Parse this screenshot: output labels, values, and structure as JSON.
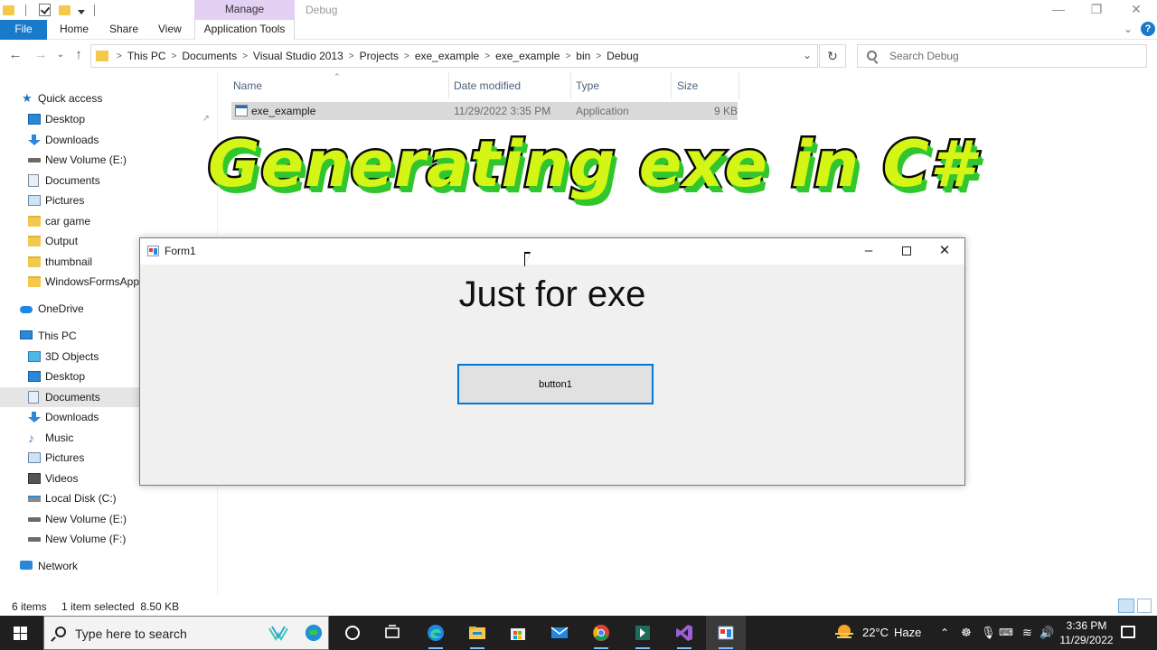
{
  "explorer": {
    "title_context_tab": "Manage",
    "title_folder": "Debug",
    "ribbon_tabs": {
      "file": "File",
      "home": "Home",
      "share": "Share",
      "view": "View",
      "app_tools": "Application Tools"
    },
    "address": {
      "crumbs": [
        "This PC",
        "Documents",
        "Visual Studio 2013",
        "Projects",
        "exe_example",
        "exe_example",
        "bin",
        "Debug"
      ],
      "search_placeholder": "Search Debug"
    },
    "sidebar": {
      "quick_access": "Quick access",
      "items": [
        {
          "label": "Desktop",
          "icon": "desktop-icon"
        },
        {
          "label": "Downloads",
          "icon": "downloads-icon"
        },
        {
          "label": "New Volume (E:)",
          "icon": "drive-icon"
        },
        {
          "label": "Documents",
          "icon": "documents-icon"
        },
        {
          "label": "Pictures",
          "icon": "pictures-icon"
        },
        {
          "label": "car game",
          "icon": "folder-icon"
        },
        {
          "label": "Output",
          "icon": "folder-icon"
        },
        {
          "label": "thumbnail",
          "icon": "folder-icon"
        },
        {
          "label": "WindowsFormsApplication",
          "icon": "folder-icon"
        }
      ],
      "onedrive": "OneDrive",
      "this_pc": "This PC",
      "pc_items": [
        {
          "label": "3D Objects",
          "icon": "3d-objects-icon"
        },
        {
          "label": "Desktop",
          "icon": "desktop-icon"
        },
        {
          "label": "Documents",
          "icon": "documents-icon"
        },
        {
          "label": "Downloads",
          "icon": "downloads-icon"
        },
        {
          "label": "Music",
          "icon": "music-icon"
        },
        {
          "label": "Pictures",
          "icon": "pictures-icon"
        },
        {
          "label": "Videos",
          "icon": "videos-icon"
        },
        {
          "label": "Local Disk (C:)",
          "icon": "local-disk-icon"
        },
        {
          "label": "New Volume (E:)",
          "icon": "drive-icon"
        },
        {
          "label": "New Volume (F:)",
          "icon": "drive-icon"
        }
      ],
      "network": "Network"
    },
    "columns": {
      "name": "Name",
      "date": "Date modified",
      "type": "Type",
      "size": "Size"
    },
    "files": [
      {
        "name": "exe_example",
        "date": "11/29/2022 3:35 PM",
        "type": "Application",
        "size": "9 KB"
      }
    ],
    "status": {
      "count": "6 items",
      "selected": "1 item selected  8.50 KB"
    }
  },
  "headline": "Generating exe in C#",
  "form1": {
    "title": "Form1",
    "label": "Just for exe",
    "button": "button1"
  },
  "taskbar": {
    "search_placeholder": "Type here to search",
    "weather_temp": "22°C",
    "weather_desc": "Haze",
    "time": "3:36 PM",
    "date": "11/29/2022"
  },
  "colors": {
    "accent": "#1979ca",
    "manage_tab": "#e4d0f2",
    "headline_fill": "#d4f516",
    "headline_shadow": "#31c62e",
    "button_border": "#0078d7"
  }
}
